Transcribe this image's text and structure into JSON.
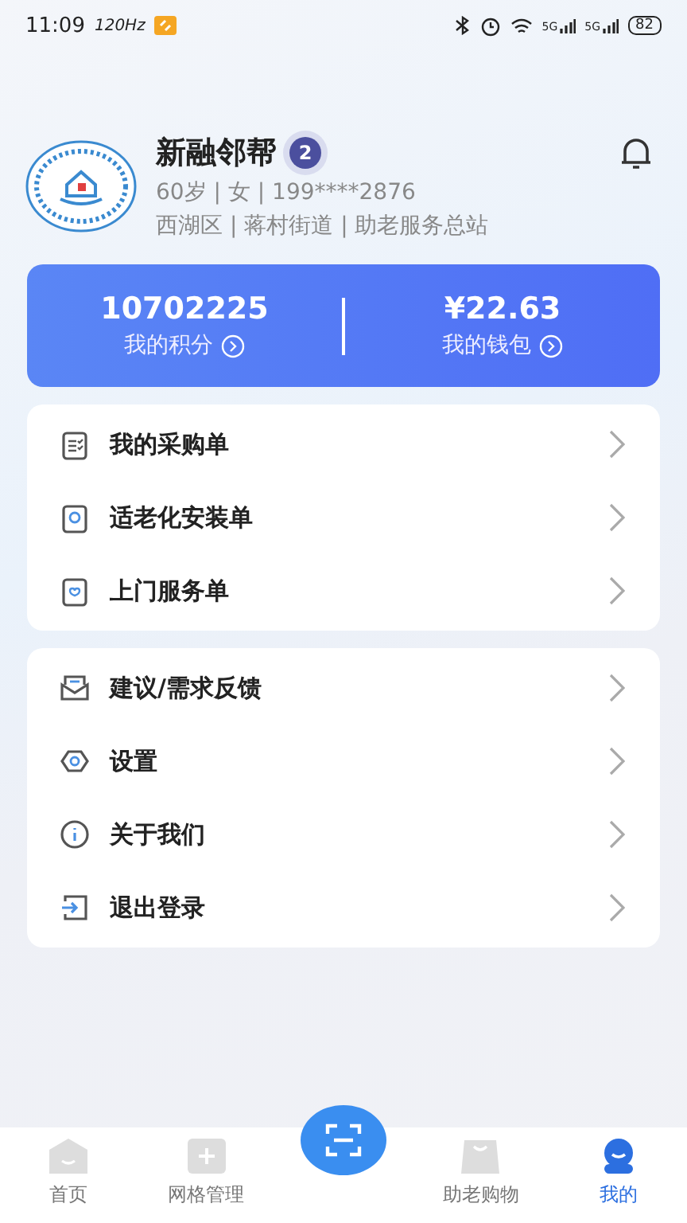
{
  "status_bar": {
    "time": "11:09",
    "refresh": "120Hz",
    "signals": [
      "5G",
      "5G"
    ],
    "battery": "82"
  },
  "profile": {
    "name": "新融邻帮",
    "level_badge": "2",
    "details": "60岁 | 女 | 199****2876",
    "address": "西湖区 | 蒋村街道 | 助老服务总站"
  },
  "stats": [
    {
      "value": "10702225",
      "label": "我的积分"
    },
    {
      "value": "¥22.63",
      "label": "我的钱包"
    }
  ],
  "menu_groups": [
    [
      {
        "label": "我的采购单"
      },
      {
        "label": "适老化安装单"
      },
      {
        "label": "上门服务单"
      }
    ],
    [
      {
        "label": "建议/需求反馈"
      },
      {
        "label": "设置"
      },
      {
        "label": "关于我们"
      },
      {
        "label": "退出登录"
      }
    ]
  ],
  "tab_bar": [
    {
      "kind": "tab",
      "label": "首页",
      "selected": false
    },
    {
      "kind": "tab",
      "label": "网格管理",
      "selected": false
    },
    {
      "kind": "scan"
    },
    {
      "kind": "tab",
      "label": "助老购物",
      "selected": false
    },
    {
      "kind": "tab",
      "label": "我的",
      "selected": true
    }
  ]
}
